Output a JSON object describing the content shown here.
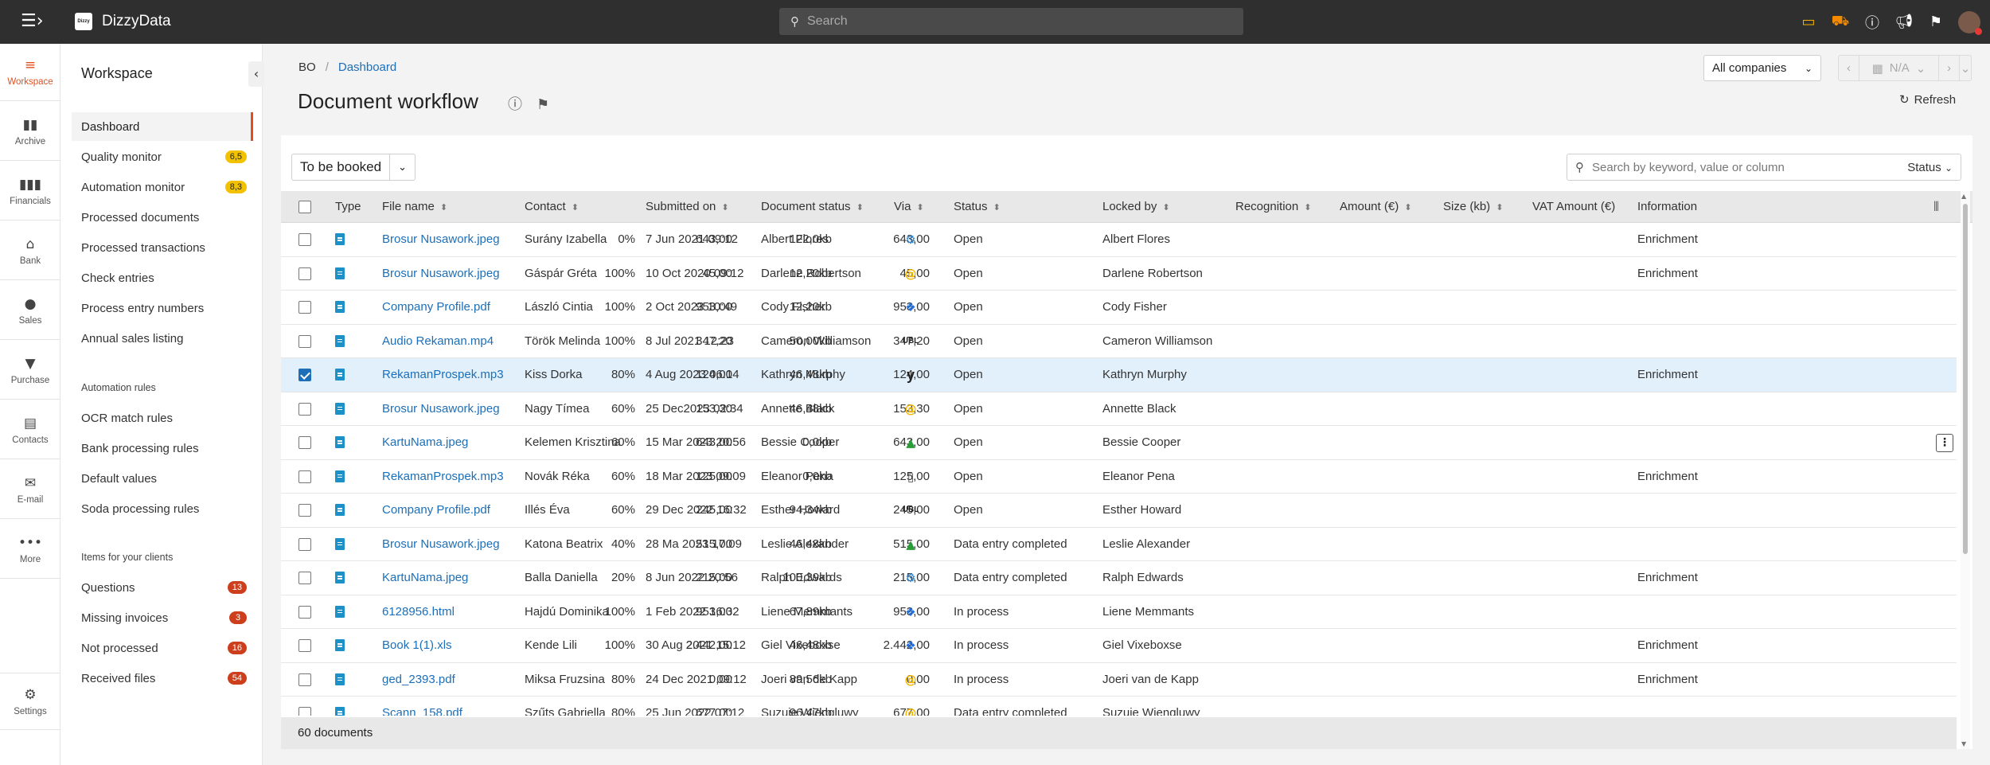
{
  "app": {
    "title": "DizzyData",
    "logo_text": "Dizzy",
    "search_placeholder": "Search"
  },
  "topbar_icons": [
    "wallet-icon",
    "cart-icon",
    "info-icon",
    "megaphone-icon",
    "bookmark-icon"
  ],
  "rail": [
    {
      "label": "Workspace",
      "icon": "workspace-icon",
      "glyph": "≡",
      "active": true
    },
    {
      "label": "Archive",
      "icon": "archive-icon",
      "glyph": "▮▮"
    },
    {
      "label": "Financials",
      "icon": "financials-icon",
      "glyph": "▮▮▮"
    },
    {
      "label": "Bank",
      "icon": "bank-icon",
      "glyph": "⌂"
    },
    {
      "label": "Sales",
      "icon": "sales-icon",
      "glyph": "●"
    },
    {
      "label": "Purchase",
      "icon": "purchase-icon",
      "glyph": "▼"
    },
    {
      "label": "Contacts",
      "icon": "contacts-icon",
      "glyph": "▤"
    },
    {
      "label": "E-mail",
      "icon": "email-icon",
      "glyph": "✉"
    },
    {
      "label": "More",
      "icon": "more-icon",
      "glyph": "•••"
    },
    {
      "label": "Settings",
      "icon": "settings-icon",
      "glyph": "⚙"
    }
  ],
  "sidebar": {
    "title": "Workspace",
    "items": [
      {
        "label": "Dashboard",
        "active": true
      },
      {
        "label": "Quality monitor",
        "badge": "6,5",
        "badge_color": "yellow"
      },
      {
        "label": "Automation monitor",
        "badge": "8,3",
        "badge_color": "yellow"
      },
      {
        "label": "Processed documents"
      },
      {
        "label": "Processed transactions"
      },
      {
        "label": "Check entries"
      },
      {
        "label": "Process entry numbers"
      },
      {
        "label": "Annual sales listing"
      }
    ],
    "automation_heading": "Automation rules",
    "automation_items": [
      {
        "label": "OCR match rules"
      },
      {
        "label": "Bank processing rules"
      },
      {
        "label": "Default values"
      },
      {
        "label": "Soda processing rules"
      }
    ],
    "clients_heading": "Items for your clients",
    "client_items": [
      {
        "label": "Questions",
        "badge": "13"
      },
      {
        "label": "Missing invoices",
        "badge": "3"
      },
      {
        "label": "Not processed",
        "badge": "16"
      },
      {
        "label": "Received files",
        "badge": "54"
      }
    ]
  },
  "breadcrumb": {
    "root": "BO",
    "current": "Dashboard"
  },
  "page": {
    "title": "Document workflow",
    "refresh_label": "Refresh"
  },
  "companies_select": "All companies",
  "period": "N/A",
  "filter": {
    "value": "To be booked"
  },
  "table_search": {
    "placeholder": "Search by keyword, value or column",
    "status_label": "Status"
  },
  "columns": [
    "Type",
    "File name",
    "Contact",
    "Submitted on",
    "Document status",
    "Via",
    "Status",
    "Locked by",
    "Recognition",
    "Amount (€)",
    "Size (kb)",
    "VAT Amount (€)",
    "Information"
  ],
  "rows": [
    {
      "file": "Brosur Nusawork.jpeg",
      "contact": "Surány Izabella",
      "submitted": "7 Jun 2021 09:12",
      "doc_status": "Albert Flores",
      "via": "gear",
      "status": "Open",
      "locked": "Albert Flores",
      "recognition": "0%",
      "amount": "643,00",
      "size": "122,0kb",
      "vat": "643,00",
      "info": "Enrichment"
    },
    {
      "file": "Brosur Nusawork.jpeg",
      "contact": "Gáspár Gréta",
      "submitted": "10 Oct 2020 09:12",
      "doc_status": "Darlene Robertson",
      "via": "at",
      "status": "Open",
      "locked": "Darlene Robertson",
      "recognition": "100%",
      "amount": "45,00",
      "size": "12,20kb",
      "vat": "45,00",
      "info": "Enrichment"
    },
    {
      "file": "Company Profile.pdf",
      "contact": "László Cintia",
      "submitted": "2 Oct 2023 10:49",
      "doc_status": "Cody Fisher",
      "via": "dropbox",
      "status": "Open",
      "locked": "Cody Fisher",
      "recognition": "100%",
      "amount": "953,00",
      "size": "12,20kb",
      "vat": "953,00",
      "info": ""
    },
    {
      "file": "Audio Rekaman.mp4",
      "contact": "Török Melinda",
      "submitted": "8 Jul 2021 12:23",
      "doc_status": "Cameron Williamson",
      "via": "ubl",
      "status": "Open",
      "locked": "Cameron Williamson",
      "recognition": "100%",
      "amount": "347,20",
      "size": "50,00kb",
      "vat": "347,20",
      "info": ""
    },
    {
      "file": "RekamanProspek.mp3",
      "contact": "Kiss Dorka",
      "submitted": "4 Aug 2023 06:14",
      "doc_status": "Kathryn Murphy",
      "via": "y",
      "status": "Open",
      "locked": "Kathryn Murphy",
      "recognition": "80%",
      "amount": "124,00",
      "size": "46,48kb",
      "vat": "124,00",
      "info": "Enrichment",
      "selected": true
    },
    {
      "file": "Brosur Nusawork.jpeg",
      "contact": "Nagy Tímea",
      "submitted": "25 Dec2023 02:34",
      "doc_status": "Annette Black",
      "via": "at",
      "status": "Open",
      "locked": "Annette Black",
      "recognition": "60%",
      "amount": "153,30",
      "size": "46,48kb",
      "vat": "153,30",
      "info": ""
    },
    {
      "file": "KartuNama.jpeg",
      "contact": "Kelemen Krisztina",
      "submitted": "15 Mar 2023 20:56",
      "doc_status": "Bessie Cooper",
      "via": "gdrive",
      "status": "Open",
      "locked": "Bessie Cooper",
      "recognition": "60%",
      "amount": "643,00",
      "size": "0,0kb",
      "vat": "643,00",
      "info": "",
      "menu": true
    },
    {
      "file": "RekamanProspek.mp3",
      "contact": "Novák Réka",
      "submitted": "18 Mar 2023 09:09",
      "doc_status": "Eleanor Pena",
      "via": "phone",
      "status": "Open",
      "locked": "Eleanor Pena",
      "recognition": "60%",
      "amount": "125,00",
      "size": "0,0kb",
      "vat": "125,00",
      "info": "Enrichment"
    },
    {
      "file": "Company Profile.pdf",
      "contact": "Illés Éva",
      "submitted": "29 Dec 2022 16:32",
      "doc_status": "Esther Howard",
      "via": "ubl",
      "status": "Open",
      "locked": "Esther Howard",
      "recognition": "60%",
      "amount": "245,00",
      "size": "94,34kb",
      "vat": "245,00",
      "info": ""
    },
    {
      "file": "Brosur Nusawork.jpeg",
      "contact": "Katona Beatrix",
      "submitted": "28 Ma 2023 17:09",
      "doc_status": "Leslie Alexander",
      "via": "gdrive",
      "status": "Data entry completed",
      "locked": "Leslie Alexander",
      "recognition": "40%",
      "amount": "515,00",
      "size": "46,48kb",
      "vat": "515,00",
      "info": ""
    },
    {
      "file": "KartuNama.jpeg",
      "contact": "Balla Daniella",
      "submitted": "8 Jun 2022 20:56",
      "doc_status": "Ralph Edwards",
      "via": "gear",
      "status": "Data entry completed",
      "locked": "Ralph Edwards",
      "recognition": "20%",
      "amount": "215,00",
      "size": "100,39kb",
      "vat": "215,00",
      "info": "Enrichment"
    },
    {
      "file": "6128956.html",
      "contact": "Hajdú Dominika",
      "submitted": "1 Feb 2022 16:32",
      "doc_status": "Liene Memmants",
      "via": "dropbox",
      "status": "In process",
      "locked": "Liene Memmants",
      "recognition": "100%",
      "amount": "953,00",
      "size": "67,89kb",
      "vat": "953,00",
      "info": ""
    },
    {
      "file": "Book 1(1).xls",
      "contact": "Kende Lili",
      "submitted": "30 Aug 2021 15:12",
      "doc_status": "Giel Vixeboxse",
      "via": "dropbox",
      "status": "In process",
      "locked": "Giel Vixeboxse",
      "recognition": "100%",
      "amount": "2.442,00",
      "size": "46,48kb",
      "vat": "2.442,00",
      "info": "Enrichment"
    },
    {
      "file": "ged_2393.pdf",
      "contact": "Miksa Fruzsina",
      "submitted": "24 Dec 2021 09:12",
      "doc_status": "Joeri van de Kapp",
      "via": "at",
      "status": "In process",
      "locked": "Joeri van de Kapp",
      "recognition": "80%",
      "amount": "0,00",
      "size": "89,56kb",
      "vat": "0,00",
      "info": "Enrichment"
    },
    {
      "file": "Scann_158.pdf",
      "contact": "Szűts Gabriella",
      "submitted": "25 Jun 2022 07:12",
      "doc_status": "Suzuie Wiengluwy",
      "via": "at",
      "status": "Data entry completed",
      "locked": "Suzuie Wiengluwy",
      "recognition": "80%",
      "amount": "677,00",
      "size": "96,47kb",
      "vat": "677,00",
      "info": ""
    }
  ],
  "footer": {
    "count_label": "60 documents"
  },
  "colors": {
    "accent": "#e24f1c",
    "link": "#1c6fb8",
    "topbar": "#2f2f2f",
    "selected_row": "#e2f0fb"
  }
}
